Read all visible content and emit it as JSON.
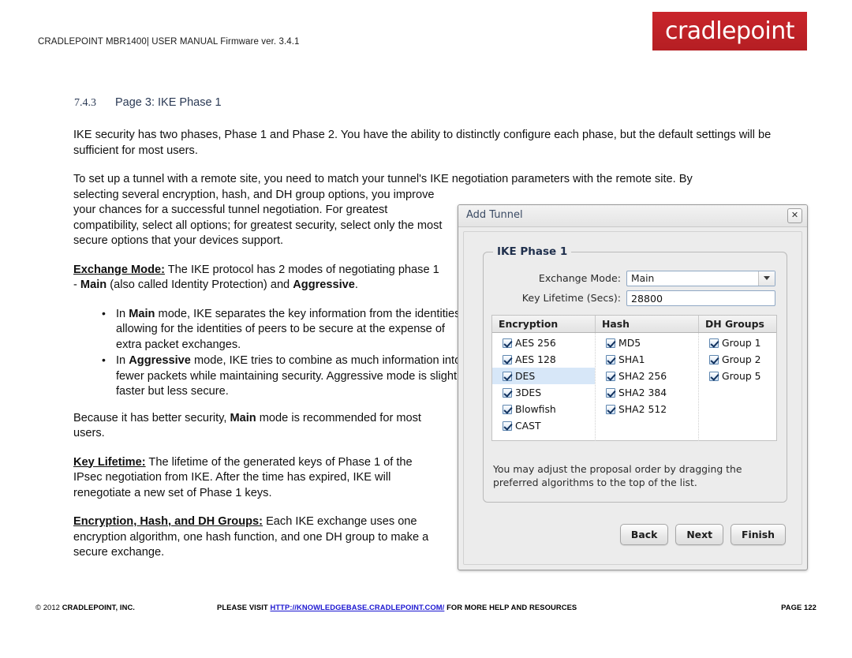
{
  "header": {
    "manual_line": "CRADLEPOINT MBR1400| USER MANUAL Firmware ver. 3.4.1",
    "logo_text": "cradlepoint",
    "logo_color": "#c02026"
  },
  "heading": {
    "number": "7.4.3",
    "title": "Page 3: IKE Phase 1",
    "color": "#2b3a55"
  },
  "body": {
    "p1": "IKE security has two phases, Phase 1 and Phase 2. You have the ability to distinctly configure each phase, but the default settings will be sufficient for most users.",
    "p2_full": "To set up a tunnel with a remote site, you need to match your tunnel's IKE negotiation parameters with the remote site. By",
    "p2_rest": "selecting several encryption, hash, and DH group options, you improve your chances for a successful tunnel negotiation. For greatest compatibility, select all options; for greatest security, select only the most secure options that your devices support.",
    "exchange_mode_term": "Exchange Mode:",
    "exchange_mode_text_a": " The IKE protocol has 2 modes of negotiating phase 1 - ",
    "exchange_mode_bold_main": "Main",
    "exchange_mode_text_b": " (also called Identity Protection) and ",
    "exchange_mode_bold_aggr": "Aggressive",
    "exchange_mode_text_c": ".",
    "bullet1_a": "In ",
    "bullet1_bold": "Main",
    "bullet1_b": " mode, IKE separates the key information from the identities, allowing for the identities of peers to be secure at the expense of extra packet exchanges.",
    "bullet2_a": "In ",
    "bullet2_bold": "Aggressive",
    "bullet2_b": " mode, IKE tries to combine as much information into fewer packets while maintaining security. Aggressive mode is slightly faster but less secure.",
    "p3_a": "Because it has better security, ",
    "p3_bold": "Main",
    "p3_b": " mode is recommended for most users.",
    "key_lifetime_term": "Key Lifetime:",
    "key_lifetime_text": " The lifetime of the generated keys of Phase 1 of the IPsec negotiation from IKE. After the time has expired, IKE will renegotiate a new set of Phase 1 keys.",
    "enc_hash_dh_term": "Encryption, Hash, and DH Groups:",
    "enc_hash_dh_text": " Each IKE exchange uses one encryption algorithm, one hash function, and one DH group to make a secure exchange."
  },
  "dialog": {
    "title": "Add Tunnel",
    "close_icon": "close-icon",
    "close_glyph": "✕",
    "fieldset_legend": "IKE Phase 1",
    "fields": [
      {
        "label": "Exchange Mode:",
        "value": "Main",
        "type": "select"
      },
      {
        "label": "Key Lifetime (Secs):",
        "value": "28800",
        "type": "text"
      }
    ],
    "table": {
      "headers": [
        "Encryption",
        "Hash",
        "DH Groups"
      ],
      "columns": [
        [
          {
            "label": "AES 256",
            "checked": true,
            "selected": false
          },
          {
            "label": "AES 128",
            "checked": true,
            "selected": false
          },
          {
            "label": "DES",
            "checked": true,
            "selected": true
          },
          {
            "label": "3DES",
            "checked": true,
            "selected": false
          },
          {
            "label": "Blowfish",
            "checked": true,
            "selected": false
          },
          {
            "label": "CAST",
            "checked": true,
            "selected": false
          }
        ],
        [
          {
            "label": "MD5",
            "checked": true,
            "selected": false
          },
          {
            "label": "SHA1",
            "checked": true,
            "selected": false
          },
          {
            "label": "SHA2 256",
            "checked": true,
            "selected": false
          },
          {
            "label": "SHA2 384",
            "checked": true,
            "selected": false
          },
          {
            "label": "SHA2 512",
            "checked": true,
            "selected": false
          }
        ],
        [
          {
            "label": "Group 1",
            "checked": true,
            "selected": false
          },
          {
            "label": "Group 2",
            "checked": true,
            "selected": false
          },
          {
            "label": "Group 5",
            "checked": true,
            "selected": false
          }
        ]
      ]
    },
    "note": "You may adjust the proposal order by dragging the preferred algorithms to the top of the list.",
    "buttons": [
      "Back",
      "Next",
      "Finish"
    ],
    "selection_color": "#d7e7f8"
  },
  "footer": {
    "copyright_symbol": "© 2012 ",
    "company": "CRADLEPOINT, INC.",
    "please_visit": "PLEASE VISIT ",
    "url": "HTTP://KNOWLEDGEBASE.CRADLEPOINT.COM/",
    "visit_tail": " FOR MORE HELP AND RESOURCES",
    "page": "PAGE 122",
    "link_color": "#1b16d0"
  }
}
